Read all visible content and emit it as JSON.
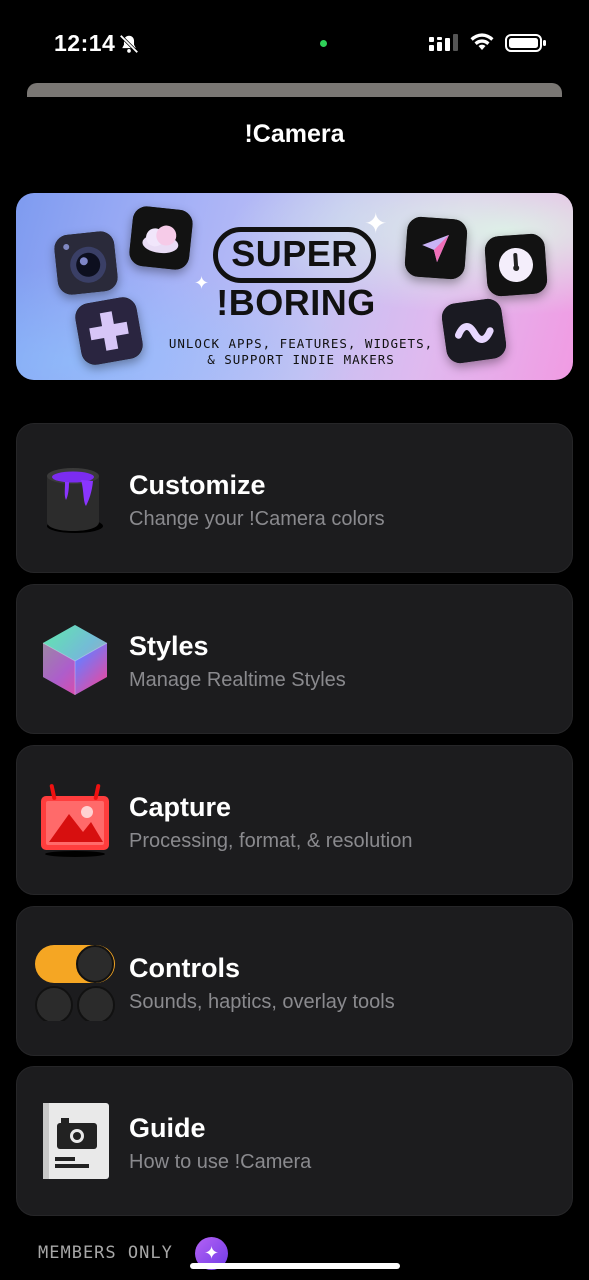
{
  "status_bar": {
    "time": "12:14",
    "icons": [
      "bell-slash-icon",
      "signal-icon",
      "wifi-icon",
      "battery-icon"
    ],
    "camera_indicator_color": "#2fd158"
  },
  "header": {
    "title": "!Camera"
  },
  "banner": {
    "line1": "SUPER",
    "line2": "!BORING",
    "subtitle_line1": "UNLOCK APPS, FEATURES, WIDGETS,",
    "subtitle_line2": "& SUPPORT INDIE MAKERS",
    "icons": [
      "camera-app-icon",
      "cloud-app-icon",
      "plus-app-icon",
      "paper-plane-app-icon",
      "timer-app-icon",
      "wave-app-icon",
      "sparkle-icon"
    ]
  },
  "menu": [
    {
      "title": "Customize",
      "subtitle": "Change your !Camera colors",
      "icon": "paint-bucket-icon"
    },
    {
      "title": "Styles",
      "subtitle": "Manage Realtime Styles",
      "icon": "color-cube-icon"
    },
    {
      "title": "Capture",
      "subtitle": "Processing, format, & resolution",
      "icon": "photo-frame-icon"
    },
    {
      "title": "Controls",
      "subtitle": "Sounds, haptics, overlay tools",
      "icon": "toggles-icon"
    },
    {
      "title": "Guide",
      "subtitle": "How to use !Camera",
      "icon": "guide-book-icon"
    }
  ],
  "footer": {
    "members_label": "MEMBERS ONLY",
    "badge_icon": "sparkle-badge-icon"
  },
  "colors": {
    "background": "#000000",
    "card": "#1c1c1e",
    "subtitle": "#8a8a8e",
    "accent_purple": "#8b5cf6"
  }
}
